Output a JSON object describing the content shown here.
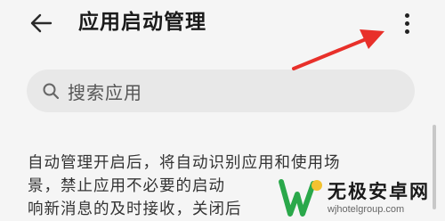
{
  "header": {
    "title": "应用启动管理",
    "back_icon": "arrow-left-icon",
    "more_icon": "more-vertical-icon"
  },
  "search": {
    "placeholder": "搜索应用",
    "icon": "search-icon"
  },
  "description": {
    "lines": [
      "自动管理开启后，将自动识别应用和使用场",
      "景，禁止应用不必要的启动",
      "响新消息的及时接收，关闭后"
    ]
  },
  "annotation": {
    "arrow_color": "#e8302a"
  },
  "watermark": {
    "title": "无极安卓网",
    "url": "wjhotelgroup.com",
    "colors": {
      "green": "#2aa84a",
      "yellow": "#f2c230"
    }
  }
}
